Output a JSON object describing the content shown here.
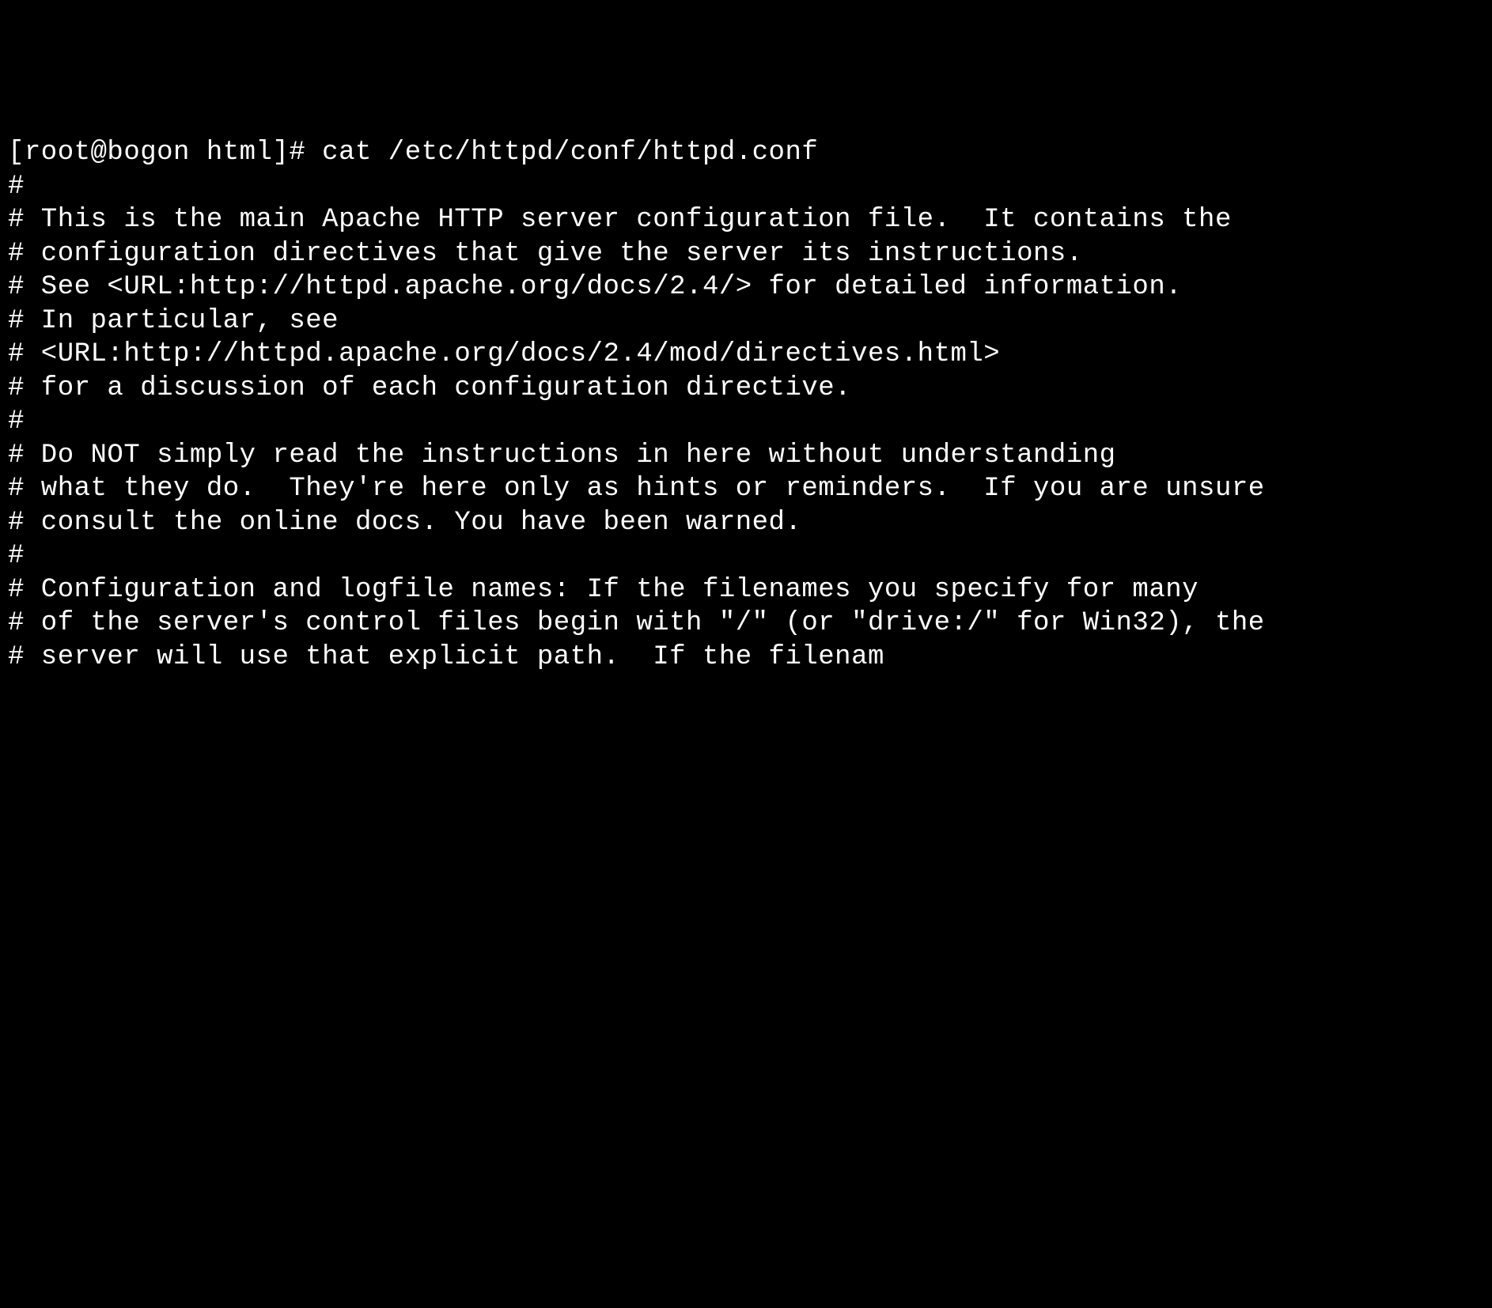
{
  "terminal": {
    "prompt": "[root@bogon html]# ",
    "command": "cat /etc/httpd/conf/httpd.conf",
    "output_lines": [
      "#",
      "# This is the main Apache HTTP server configuration file.  It contains the",
      "# configuration directives that give the server its instructions.",
      "# See <URL:http://httpd.apache.org/docs/2.4/> for detailed information.",
      "# In particular, see ",
      "# <URL:http://httpd.apache.org/docs/2.4/mod/directives.html>",
      "# for a discussion of each configuration directive.",
      "#",
      "# Do NOT simply read the instructions in here without understanding",
      "# what they do.  They're here only as hints or reminders.  If you are unsure",
      "# consult the online docs. You have been warned.  ",
      "#",
      "# Configuration and logfile names: If the filenames you specify for many",
      "# of the server's control files begin with \"/\" (or \"drive:/\" for Win32), the",
      "# server will use that explicit path.  If the filenam"
    ]
  }
}
